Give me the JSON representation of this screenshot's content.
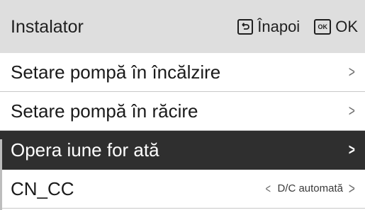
{
  "header": {
    "title": "Instalator",
    "back_label": "Înapoi",
    "ok_label": "OK",
    "ok_key": "OK",
    "back_icon": "back-key-icon"
  },
  "menu": {
    "items": [
      {
        "label": "Setare pompă în încălzire",
        "selected": false
      },
      {
        "label": "Setare pompă în răcire",
        "selected": false
      },
      {
        "label": "Opera iune for ată",
        "selected": true
      },
      {
        "label": "CN_CC",
        "value": "D/C automată",
        "selected": false
      }
    ]
  },
  "colors": {
    "header_bg": "#dedede",
    "selected_bg": "#2f2f2f",
    "selected_text": "#ffffff"
  }
}
